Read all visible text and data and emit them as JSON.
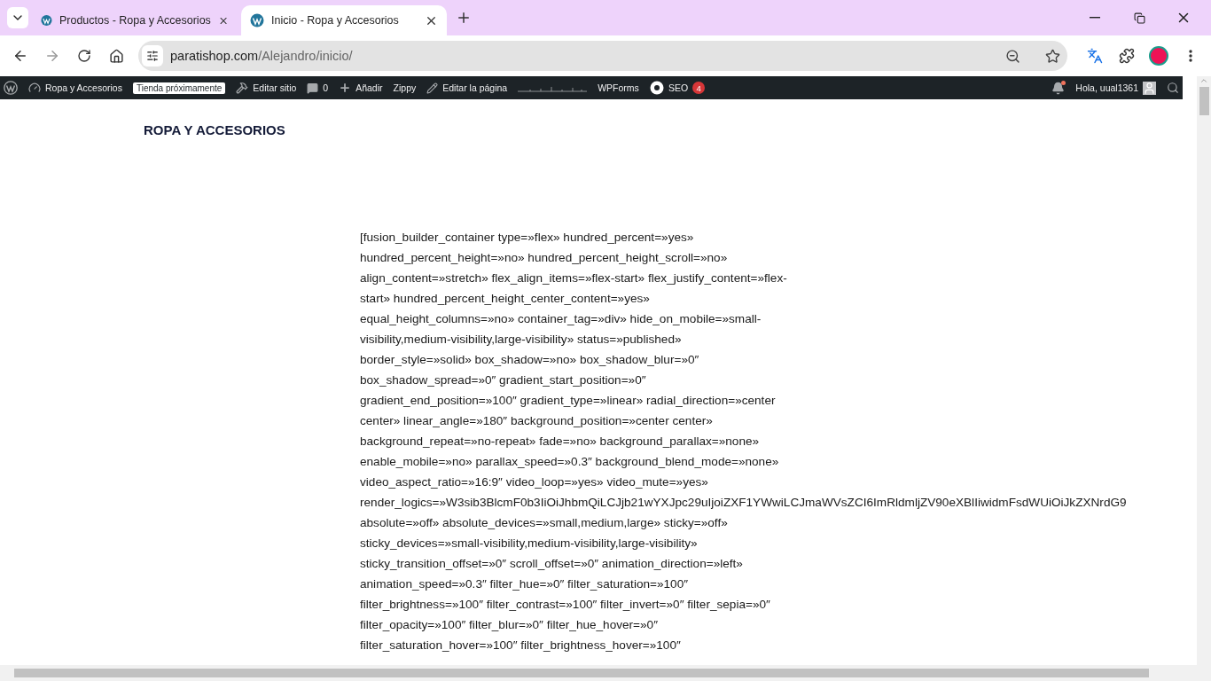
{
  "browser": {
    "tabs": [
      {
        "title": "Productos - Ropa y Accesorios",
        "selected": false
      },
      {
        "title": "Inicio - Ropa y Accesorios",
        "selected": true
      }
    ],
    "address": {
      "domain": "paratishop.com",
      "path": "/Alejandro/inicio/"
    }
  },
  "admin_bar": {
    "items": [
      {
        "kind": "site",
        "label": "Ropa y Accesorios"
      },
      {
        "kind": "badge",
        "label": "Tienda próximamente"
      },
      {
        "kind": "edit-site",
        "label": "Editar sitio"
      },
      {
        "kind": "comments",
        "label": "0"
      },
      {
        "kind": "add",
        "label": "Añadir"
      },
      {
        "kind": "plain",
        "label": "Zippy"
      },
      {
        "kind": "edit-page",
        "label": "Editar la página"
      },
      {
        "kind": "sparkline"
      },
      {
        "kind": "plain",
        "label": "WPForms"
      },
      {
        "kind": "seo",
        "label": "SEO",
        "count": "4"
      }
    ],
    "notifications_unread": true,
    "greeting": "Hola, uual1361"
  },
  "page": {
    "site_title": "ROPA Y ACCESORIOS",
    "content_lines": [
      "[fusion_builder_container type=»flex» hundred_percent=»yes»",
      "hundred_percent_height=»no» hundred_percent_height_scroll=»no»",
      "align_content=»stretch» flex_align_items=»flex-start» flex_justify_content=»flex-",
      "start» hundred_percent_height_center_content=»yes»",
      "equal_height_columns=»no» container_tag=»div» hide_on_mobile=»small-",
      "visibility,medium-visibility,large-visibility» status=»published»",
      "border_style=»solid» box_shadow=»no» box_shadow_blur=»0″",
      "box_shadow_spread=»0″ gradient_start_position=»0″",
      "gradient_end_position=»100″ gradient_type=»linear» radial_direction=»center",
      "center» linear_angle=»180″ background_position=»center center»",
      "background_repeat=»no-repeat» fade=»no» background_parallax=»none»",
      "enable_mobile=»no» parallax_speed=»0.3″ background_blend_mode=»none»",
      "video_aspect_ratio=»16:9″ video_loop=»yes» video_mute=»yes»",
      "render_logics=»W3sib3BlcmF0b3IiOiJhbmQiLCJjb21wYXJpc29uIjoiZXF1YWwiLCJmaWVsZCI6ImRldmljZV90eXBlIiwidmFsdWUiOiJkZXNrdG9",
      "absolute=»off» absolute_devices=»small,medium,large» sticky=»off»",
      "sticky_devices=»small-visibility,medium-visibility,large-visibility»",
      "sticky_transition_offset=»0″ scroll_offset=»0″ animation_direction=»left»",
      "animation_speed=»0.3″ filter_hue=»0″ filter_saturation=»100″",
      "filter_brightness=»100″ filter_contrast=»100″ filter_invert=»0″ filter_sepia=»0″",
      "filter_opacity=»100″ filter_blur=»0″ filter_hue_hover=»0″",
      "filter_saturation_hover=»100″ filter_brightness_hover=»100″"
    ]
  }
}
